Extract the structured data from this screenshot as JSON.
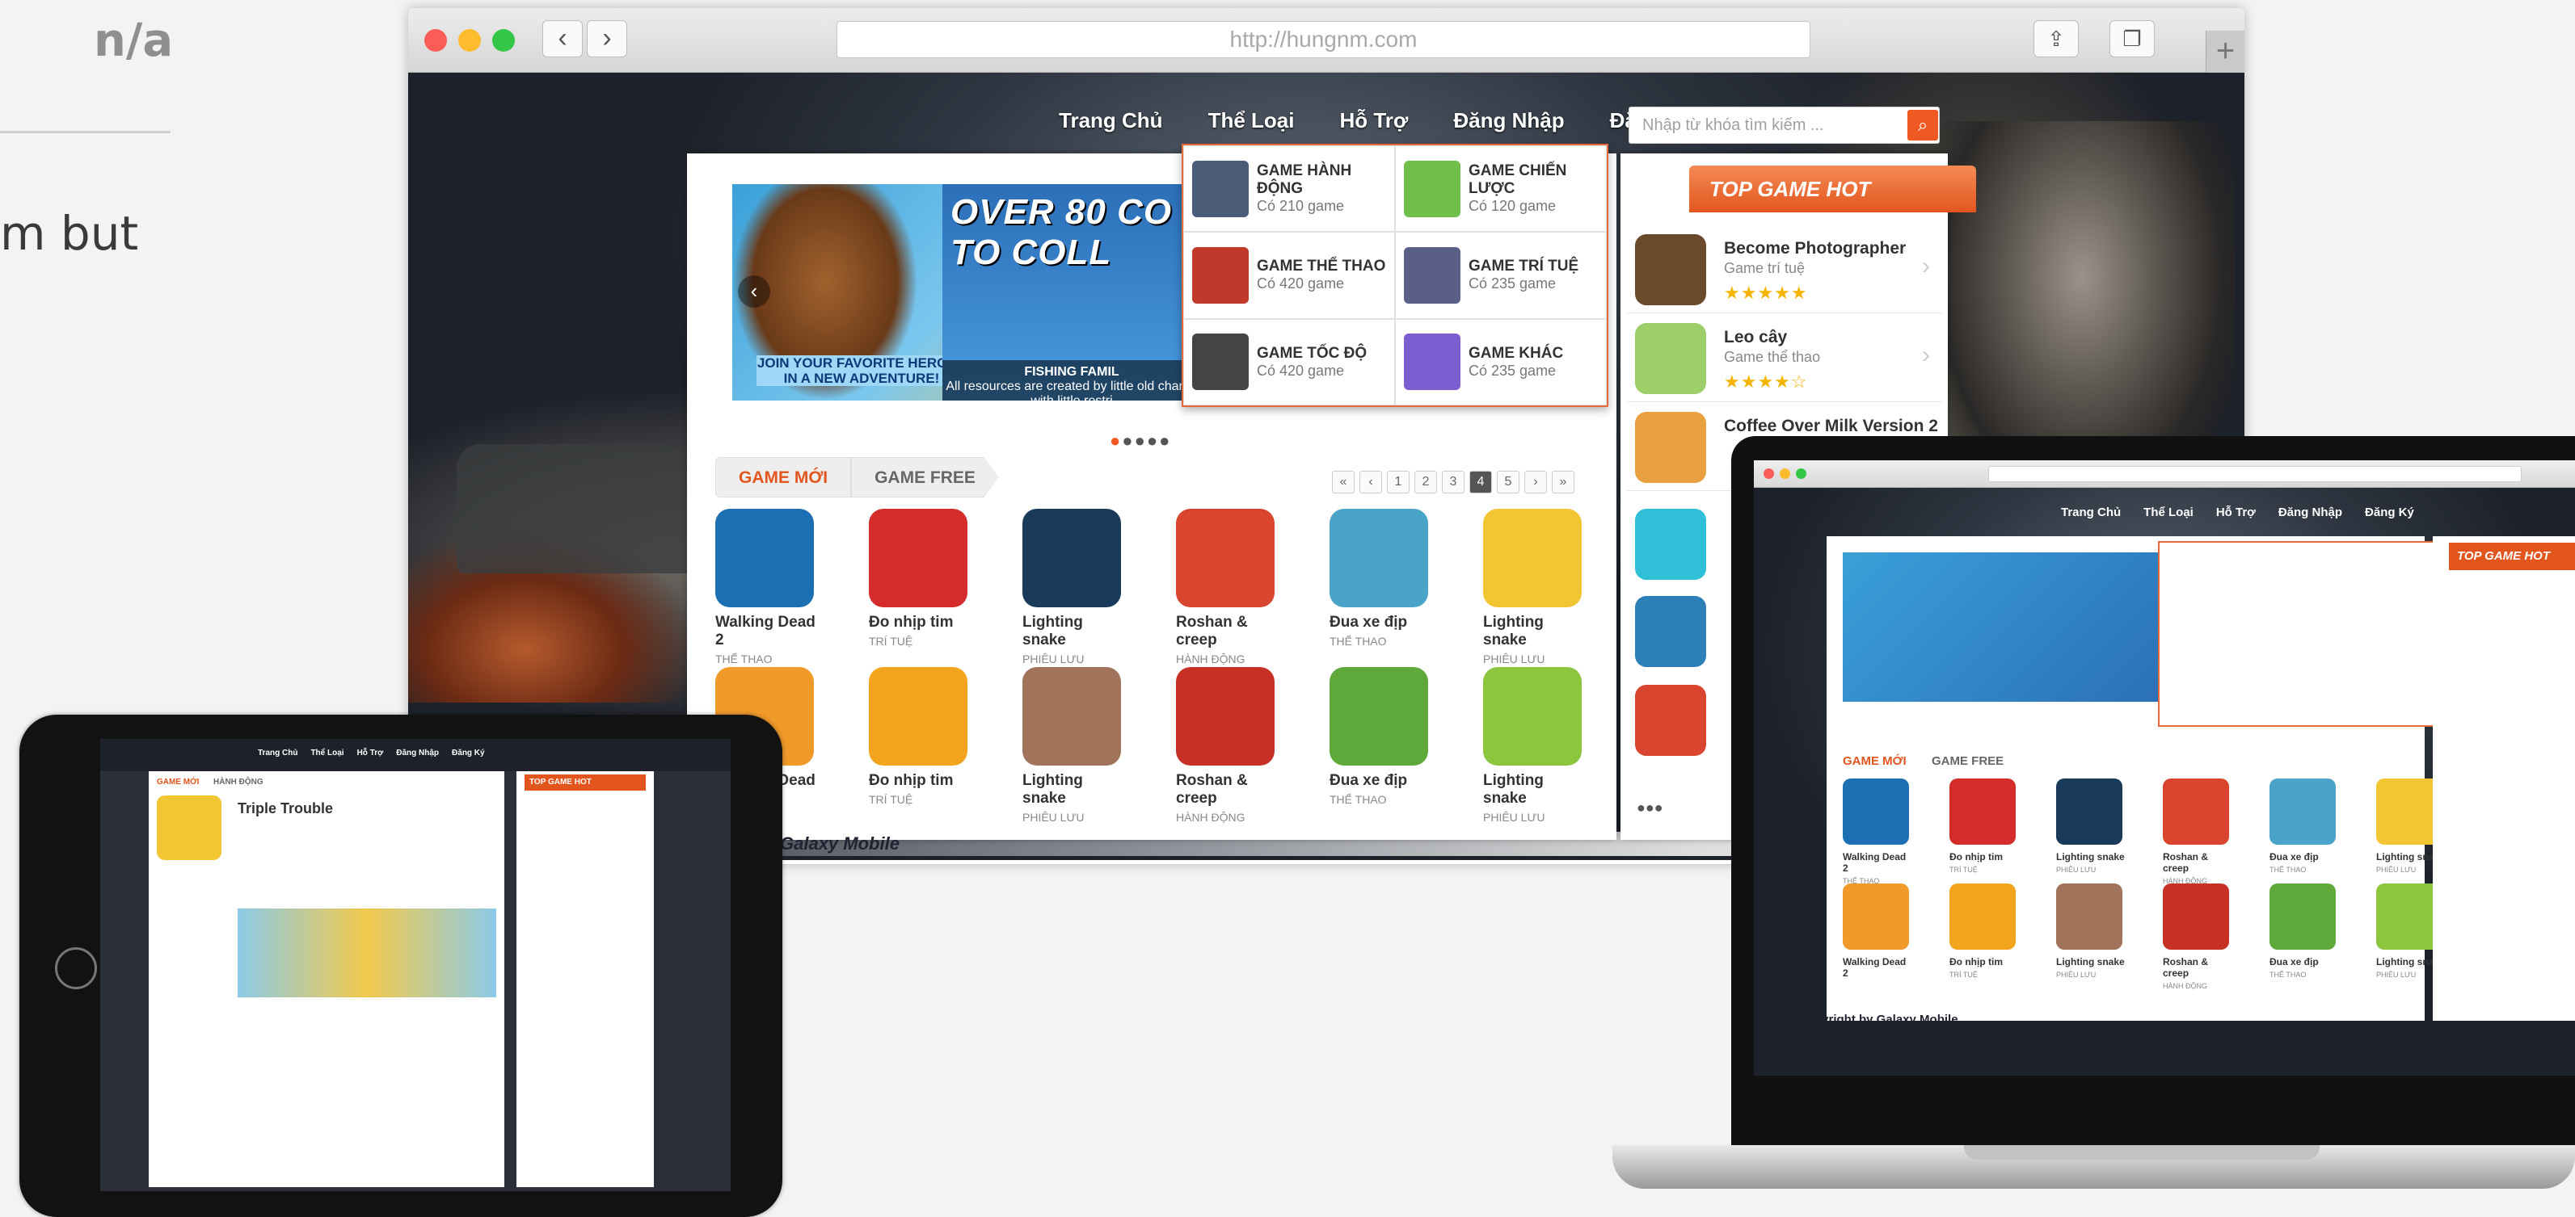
{
  "partial_left": {
    "label": "n/a",
    "text_fragment": "m but"
  },
  "browser": {
    "url": "http://hungnm.com"
  },
  "site": {
    "nav": [
      "Trang Chủ",
      "Thể Loại",
      "Hỗ Trợ",
      "Đăng Nhập",
      "Đăng Ký"
    ],
    "search_placeholder": "Nhập từ khóa tìm kiếm ...",
    "slider": {
      "banner1": "JOIN YOUR FAVORITE HEROES IN A NEW ADVENTURE!",
      "banner2_title": "OVER 80 CO TO COLL",
      "caption_title": "FISHING FAMIL",
      "caption_text": "All resources are created by little old charge with little restri"
    },
    "dropdown": [
      {
        "title": "GAME HÀNH ĐỘNG",
        "count": "Có 210 game",
        "color": "#4a5c78"
      },
      {
        "title": "GAME CHIẾN LƯỢC",
        "count": "Có 120 game",
        "color": "#6fbf4a"
      },
      {
        "title": "GAME THỂ THAO",
        "count": "Có 420 game",
        "color": "#c0392b"
      },
      {
        "title": "GAME TRÍ TUỆ",
        "count": "Có 235 game",
        "color": "#5a5f85"
      },
      {
        "title": "GAME TỐC ĐỘ",
        "count": "Có 420 game",
        "color": "#444"
      },
      {
        "title": "GAME KHÁC",
        "count": "Có 235 game",
        "color": "#7b5fd1"
      }
    ],
    "tabs": [
      "GAME MỚI",
      "GAME FREE"
    ],
    "pager": [
      "«",
      "‹",
      "1",
      "2",
      "3",
      "4",
      "5",
      "›",
      "»"
    ],
    "games_row1": [
      {
        "name": "Walking Dead 2",
        "cat": "THỂ THAO",
        "color": "#1b6fb2"
      },
      {
        "name": "Đo nhịp tim",
        "cat": "TRÍ TUỆ",
        "color": "#d62b2b"
      },
      {
        "name": "Lighting snake",
        "cat": "PHIÊU LƯU",
        "color": "#1a3a5a"
      },
      {
        "name": "Roshan & creep",
        "cat": "HÀNH ĐỘNG",
        "color": "#d9452f"
      },
      {
        "name": "Đua xe địp",
        "cat": "THỂ THAO",
        "color": "#4aa3c8"
      },
      {
        "name": "Lighting snake",
        "cat": "PHIÊU LƯU",
        "color": "#f2c633"
      }
    ],
    "games_row2": [
      {
        "name": "Walking Dead 2",
        "cat": "",
        "color": "#f09a2a"
      },
      {
        "name": "Đo nhịp tim",
        "cat": "TRÍ TUỆ",
        "color": "#f2a41c"
      },
      {
        "name": "Lighting snake",
        "cat": "PHIÊU LƯU",
        "color": "#a0735a"
      },
      {
        "name": "Roshan & creep",
        "cat": "HÀNH ĐỘNG",
        "color": "#c83226"
      },
      {
        "name": "Đua xe địp",
        "cat": "THỂ THAO",
        "color": "#5fa83a"
      },
      {
        "name": "Lighting snake",
        "cat": "PHIÊU LƯU",
        "color": "#8cc63f"
      }
    ],
    "top_hot_title": "TOP GAME HOT",
    "top_hot": [
      {
        "name": "Become Photographer",
        "genre": "Game trí tuệ",
        "stars": "★★★★★",
        "color": "#6a4a2a"
      },
      {
        "name": "Leo cây",
        "genre": "Game thể thao",
        "stars": "★★★★☆",
        "color": "#9ccf6a"
      },
      {
        "name": "Coffee Over Milk Version 2",
        "genre": "",
        "stars": "",
        "color": "#e8a040"
      }
    ],
    "footer": "Galaxy Mobile",
    "footer_full": "Copyright by Galaxy Mobile"
  },
  "tablet": {
    "game_title": "Triple Trouble",
    "tabs": [
      "GAME MỚI",
      "HÀNH ĐỘNG"
    ],
    "side_title": "TOP GAME HOT"
  }
}
